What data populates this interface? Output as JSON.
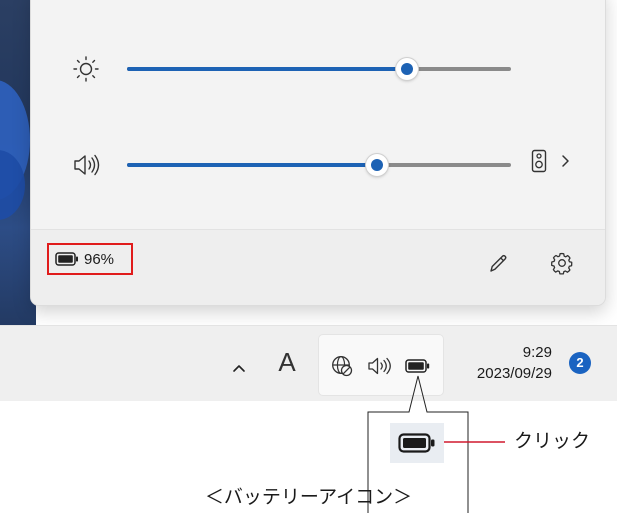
{
  "quick_settings": {
    "brightness": {
      "icon": "brightness-sun-icon",
      "level": 0.73
    },
    "volume": {
      "icon": "speaker-volume-icon",
      "level": 0.65,
      "output_device_icon": "speaker-device-icon"
    },
    "battery": {
      "percent_text": "96%",
      "highlight_color": "#e01b1b"
    },
    "edit_icon": "pencil-icon",
    "settings_icon": "gear-icon"
  },
  "taskbar": {
    "ime_label": "A",
    "time": "9:29",
    "date": "2023/09/29",
    "notification_count": "2",
    "accent_color": "#1a63c1"
  },
  "callout": {
    "click_label": "クリック",
    "caption": "＜バッテリーアイコン＞"
  }
}
